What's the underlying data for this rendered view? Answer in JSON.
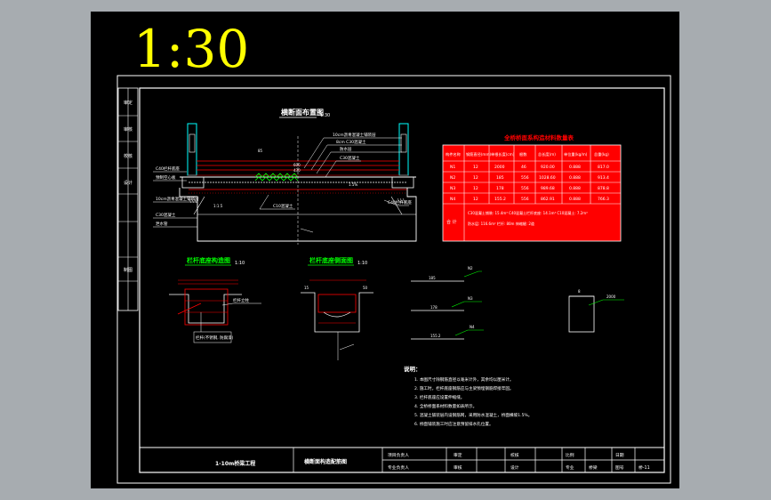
{
  "scale_label": "1:30",
  "sheet": {
    "main_title": "横断面布置图",
    "main_title_scale": "1:30",
    "detail_left_title": "栏杆底座构造图",
    "detail_left_scale": "1:10",
    "detail_right_title": "栏杆底座侧面图",
    "detail_right_scale": "1:10",
    "table_title": "全桥桥面系构造材料数量表",
    "table_headers": [
      "构件名称",
      "钢筋直径(mm)",
      "单根长度(cm)",
      "根数",
      "总长度(m)",
      "单位重(kg/m)",
      "总重(kg)"
    ],
    "table_rows": [
      [
        "N1",
        "12",
        "2000",
        "46",
        "920.00",
        "0.888",
        "817.0"
      ],
      [
        "N2",
        "12",
        "185",
        "556",
        "1028.60",
        "0.888",
        "913.4"
      ],
      [
        "N3",
        "12",
        "178",
        "556",
        "989.68",
        "0.888",
        "878.8"
      ],
      [
        "N4",
        "12",
        "155.2",
        "556",
        "862.91",
        "0.888",
        "766.3"
      ]
    ],
    "table_total_label": "合 计",
    "table_total_lines": [
      "C30混凝土铺装: 15.4m³   C40混凝土栏杆底座: 14.1m³   C10混凝土: 7.2m³",
      "防水层: 116.6m²   栏杆: 80m   伸缩缝: 2道"
    ],
    "notes_title": "说明：",
    "notes": [
      "1. 本图尺寸除钢筋直径以毫米计外，其余均以厘米计。",
      "2. 施工时，栏杆底座钢筋应与主梁预埋钢筋焊接牢固。",
      "3. 栏杆底座应设置伸缩缝。",
      "4. 全桥桥面系材料数量如表所示。",
      "5. 混凝土铺装层内设钢筋网，采用防水混凝土，桥面横坡1.5%。",
      "6. 桥面铺装施工时应注意预留排水孔位置。"
    ],
    "dim_labels": [
      "85",
      "430",
      "600",
      "1:1.5",
      "1.5%",
      "N1",
      "N2",
      "N3",
      "N4",
      "2000",
      "185",
      "178",
      "155.2",
      "8",
      "15",
      "50"
    ],
    "callouts_main": [
      "10cm沥青混凝土铺装层",
      "8cm C30混凝土",
      "防水层",
      "C30混凝土",
      "预制空心板",
      "C40栏杆底座",
      "C10混凝土",
      "泄水管"
    ],
    "callouts_detail": [
      "栏杆(不锈钢, 防腐漆)",
      "栏杆立柱"
    ],
    "title_block": {
      "project": "1-10m桥梁工程",
      "drawing_name": "横断面构造配筋图",
      "roles": [
        "项目负责人",
        "专业负责人"
      ],
      "roles2": [
        "审定",
        "审核"
      ],
      "roles3": [
        "校核",
        "设计"
      ],
      "labels": [
        "比例",
        "日期",
        "专业",
        "桥梁",
        "图号",
        "桥-11"
      ]
    },
    "left_strip": [
      "审定",
      "审核",
      "校核",
      "设计",
      "制图"
    ]
  }
}
